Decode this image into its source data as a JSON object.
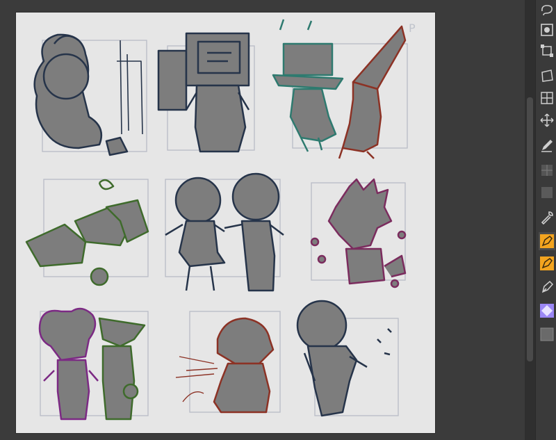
{
  "canvas": {
    "background": "#e6e6e6",
    "corner_label": "P"
  },
  "colors": {
    "workspace": "#3b3b3b",
    "sketch_fill": "#7d7d7d",
    "navy": "#26344a",
    "teal": "#2e7a6f",
    "rust": "#8c3225",
    "green": "#3f6b2c",
    "magenta": "#7b2c5e",
    "purple": "#7c2a84",
    "guide": "#b8bcc6",
    "accent_orange": "#f3a41f",
    "accent_violet": "#9b87f5"
  },
  "tools": [
    {
      "icon": "lasso-icon"
    },
    {
      "icon": "object-select-icon"
    },
    {
      "icon": "transform-icon"
    },
    {
      "icon": "free-transform-icon"
    },
    {
      "icon": "mesh-transform-icon"
    },
    {
      "icon": "move-icon"
    },
    {
      "icon": "pencil-icon"
    },
    {
      "icon": "layer-grid-icon"
    },
    {
      "icon": "gray-square-icon"
    },
    {
      "icon": "wrench-icon"
    },
    {
      "icon": "pen-tool-orange-icon"
    },
    {
      "icon": "pen-tool-orange-2-icon"
    },
    {
      "icon": "pen-nib-icon"
    },
    {
      "icon": "color-swap-icon"
    },
    {
      "icon": "gray-swatch-icon"
    }
  ]
}
